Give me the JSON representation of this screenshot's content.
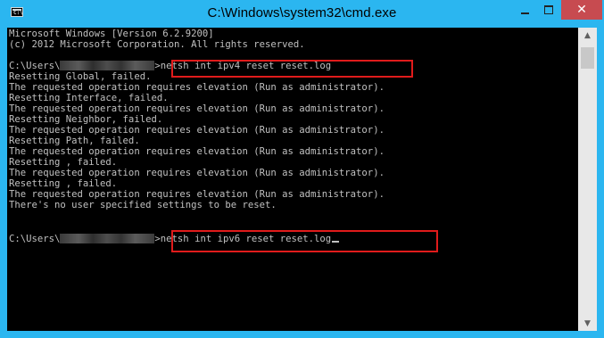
{
  "window": {
    "title": "C:\\Windows\\system32\\cmd.exe",
    "app_icon_text": "C:\\"
  },
  "console": {
    "lines": [
      "Microsoft Windows [Version 6.2.9200]",
      "(c) 2012 Microsoft Corporation. All rights reserved.",
      "",
      "",
      "Resetting Global, failed.",
      "The requested operation requires elevation (Run as administrator).",
      "Resetting Interface, failed.",
      "The requested operation requires elevation (Run as administrator).",
      "Resetting Neighbor, failed.",
      "The requested operation requires elevation (Run as administrator).",
      "Resetting Path, failed.",
      "The requested operation requires elevation (Run as administrator).",
      "Resetting , failed.",
      "The requested operation requires elevation (Run as administrator).",
      "Resetting , failed.",
      "The requested operation requires elevation (Run as administrator).",
      "There's no user specified settings to be reset."
    ],
    "prompt_prefix": "C:\\Users\\",
    "prompt_suffix": ">",
    "command_1": "netsh int ipv4 reset reset.log",
    "command_2": "netsh int ipv6 reset reset.log"
  },
  "colors": {
    "console_bg": "#000000",
    "console_text": "#c0c0c0",
    "highlight": "#e01b1b",
    "titlebar": "#2bb6f0",
    "close_button": "#c74b50"
  },
  "icons": {
    "app": "cmd-icon",
    "minimize": "minimize-icon",
    "maximize": "maximize-icon",
    "close": "close-icon"
  }
}
